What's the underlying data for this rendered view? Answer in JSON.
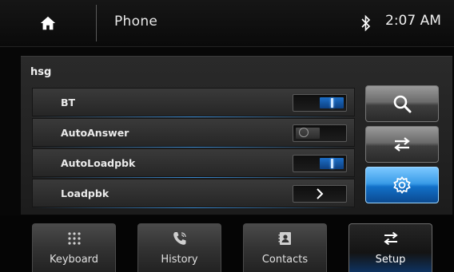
{
  "topbar": {
    "home_icon": "home-icon",
    "title": "Phone",
    "bluetooth_icon": "bluetooth-icon",
    "clock": "2:07 AM"
  },
  "device": {
    "name": "hsg"
  },
  "settings": [
    {
      "label": "BT",
      "control": "toggle",
      "state": "on"
    },
    {
      "label": "AutoAnswer",
      "control": "toggle",
      "state": "off"
    },
    {
      "label": "AutoLoadpbk",
      "control": "toggle",
      "state": "on"
    },
    {
      "label": "Loadpbk",
      "control": "chevron",
      "icon": "chevron-right-icon"
    }
  ],
  "side_buttons": [
    {
      "icon": "search-icon",
      "active": false
    },
    {
      "icon": "swap-arrows-icon",
      "active": false
    },
    {
      "icon": "gear-icon",
      "active": true
    }
  ],
  "tabs": [
    {
      "label": "Keyboard",
      "icon": "keypad-icon",
      "active": false
    },
    {
      "label": "History",
      "icon": "phone-history-icon",
      "active": false
    },
    {
      "label": "Contacts",
      "icon": "contacts-book-icon",
      "active": false
    },
    {
      "label": "Setup",
      "icon": "swap-arrows-icon",
      "active": true
    }
  ],
  "colors": {
    "accent": "#1a7fd8",
    "active_button": "#3a9ce8",
    "background": "#070707"
  }
}
